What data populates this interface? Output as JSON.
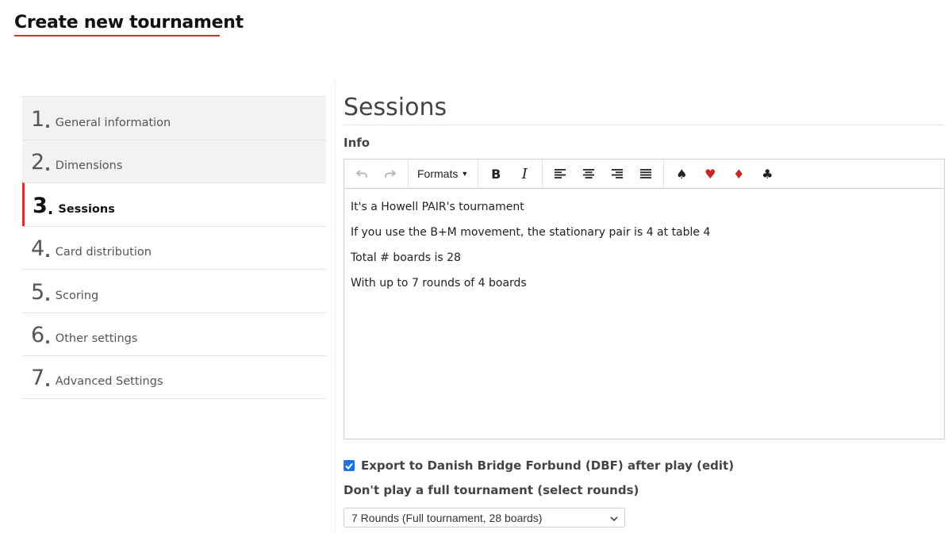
{
  "page": {
    "title": "Create new tournament"
  },
  "steps": [
    {
      "num": "1",
      "label": "General information",
      "state": "done"
    },
    {
      "num": "2",
      "label": "Dimensions",
      "state": "done"
    },
    {
      "num": "3",
      "label": "Sessions",
      "state": "active"
    },
    {
      "num": "4",
      "label": "Card distribution",
      "state": "pending"
    },
    {
      "num": "5",
      "label": "Scoring",
      "state": "pending"
    },
    {
      "num": "6",
      "label": "Other settings",
      "state": "pending"
    },
    {
      "num": "7",
      "label": "Advanced Settings",
      "state": "pending"
    }
  ],
  "main": {
    "section_title": "Sessions",
    "info_label": "Info",
    "editor": {
      "toolbar": {
        "undo_icon": "undo-icon",
        "redo_icon": "redo-icon",
        "formats_label": "Formats",
        "bold_label": "B",
        "italic_label": "I",
        "align_icons": [
          "align-left-icon",
          "align-center-icon",
          "align-right-icon",
          "align-justify-icon"
        ],
        "suits": [
          "♠",
          "♥",
          "♦",
          "♣"
        ]
      },
      "lines": [
        "It's a Howell PAIR's tournament",
        "If you use the B+M movement, the stationary pair is 4 at table 4",
        "Total # boards is 28",
        "With up to 7 rounds of 4 boards"
      ]
    },
    "export": {
      "label": "Export to Danish Bridge Forbund (DBF) after play (edit)",
      "checked": true
    },
    "partial": {
      "label": "Don't play a full tournament (select rounds)",
      "selected": "7 Rounds (Full tournament, 28 boards)"
    }
  },
  "colors": {
    "accent": "#d32f2f",
    "checkbox": "#1a73e8",
    "suit_red": "#c62828"
  }
}
